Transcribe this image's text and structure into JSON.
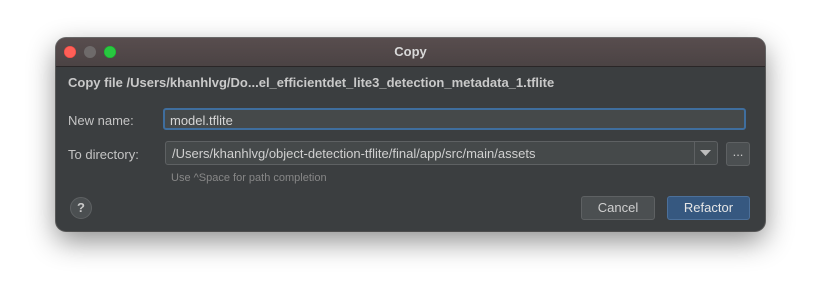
{
  "window": {
    "title": "Copy"
  },
  "dialog": {
    "header": "Copy file /Users/khanhlvg/Do...el_efficientdet_lite3_detection_metadata_1.tflite",
    "new_name_label": "New name:",
    "new_name_value": "model.tflite",
    "to_directory_label": "To directory:",
    "to_directory_value": "/Users/khanhlvg/object-detection-tflite/final/app/src/main/assets",
    "browse_label": "...",
    "hint": "Use ^Space for path completion",
    "help_label": "?",
    "cancel_label": "Cancel",
    "refactor_label": "Refactor"
  },
  "icons": {
    "traffic_lights": [
      "close-icon",
      "minimize-icon",
      "zoom-icon"
    ],
    "dropdown": "chevron-down-icon",
    "help": "help-icon"
  },
  "colors": {
    "accent": "#365880",
    "focus_border": "#3f6e9e",
    "close": "#ff5f57",
    "zoom": "#28c840"
  }
}
